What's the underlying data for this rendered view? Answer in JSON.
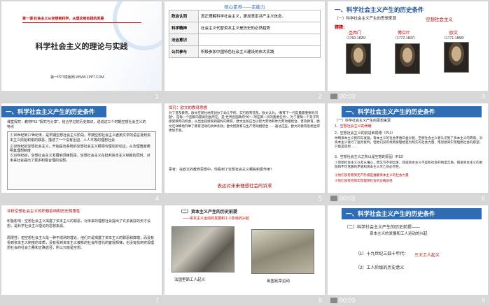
{
  "slides": [
    {
      "num": "1",
      "title": "科学社会主义的理论与实践",
      "lesson": "第一课  社会主义从空想到科学、从理论到实践的发展",
      "footer": "第一PPT模板网-WWW.1PPT.COM"
    },
    {
      "num": "2",
      "heading": "核心素养——定能力",
      "rows": [
        {
          "k": "政治认同",
          "v": "真正理解科学社会主义，更加坚定共产主义信念。"
        },
        {
          "k": "科学精神",
          "v": "社会主义代替资本主义是历史的必然趋势"
        },
        {
          "k": "法治意识",
          "v": ""
        },
        {
          "k": "公共参与",
          "v": "积极参加中国特色社会主义建设的伟大实践"
        }
      ]
    },
    {
      "num": "3",
      "time": "00:03",
      "heading": "一、科学社会主义产生的历史条件",
      "sub1": "（一）科学社会主义产生的思想来源",
      "sub2": "空想社会主义",
      "tag": "猜猜：",
      "people": [
        {
          "name": "圣西门",
          "years": "（1760-1825）"
        },
        {
          "name": "傅立叶",
          "years": "（1772-1837）"
        },
        {
          "name": "欧文",
          "years": "（1771-1858）"
        }
      ]
    },
    {
      "num": "4",
      "heading": "一、科学社会主义产生的历史条件",
      "q": "课堂探究：教材P11 \"探究与分享\"，结合学过的历史知识，说说这三个时期空想社会主义的特点",
      "items": [
        "①16世纪到17世纪末，是早期空想社会主义阶段。早期空想社会主义者用文学的语言批判资本主义原始积累的罪恶，描述了一个没有压迫、人人平等的理想社会",
        "②18世纪的空想社会主义，开始提出系统的空想社会主义纲领与理论的论证，从法理角度阐明其理想制度",
        "③19世纪初，空想社会主义发展到顶峰阶段，空想社会主义在批判资本主义制度的同时，对未来社会提出了更多积极合理的设想。"
      ]
    },
    {
      "num": "5",
      "title": "探究：欧文的教育思想",
      "body": "为了普及教育，欧文在新拉纳克创办了幼儿学校，实行教育普及。欧文认为，\"教育下一代是最最重要的问题\"，是每一个国家的最高利益所在，是\"世界各国政府\"的\"一项压倒一切的重要任务\"。为了使每一个孩子有接受教育的机会，从出生就接受到最好的教育，欧文主张应当以智力劳动和体力劳动相结合，普及教育。欧文还详细地列举了教育活动的具体条款。欧文把教育与生产劳动相结合……通过这些，欧文的教育思想显得更加丰富。",
      "question": "思考：在欧文的教育思想中，你看到了空想社会主义哪些积极作用？",
      "caption": "表达对未来理想社会的诉求"
    },
    {
      "num": "6",
      "time": "00:03",
      "heading": "一、科学社会主义产生的历史条件",
      "sub1": "（一）科学社会主义产生的思想来源",
      "tag": "1、空想社会主义的贡献",
      "p2": "2、空想社会主义的前进和局限（P11）",
      "p2body": "仲晴资本主义民间与发展，资本主义的社会矛盾日益尖锐，空想社会主义者认识到了资本主义的弊病，对资本主义进行了猛烈批判，但他们没有找到将理想变为现实的社会力量，用思想来实现理想社会的愿望，只能是空想……",
      "p3": "3、空想社会主义之所以是空想的原因（P12）",
      "p3items": [
        "①空想社会主义以及从唯心，而又写不到出发，得提资本主义不是和社会的制度实质，揭发资本主义的剥削和不可克服的矛盾和资本主义灭亡的必然性。",
        "②他们没有看到无产阶级是推翻资本主义的社会力量",
        "③他们没有找到实现理想社会的正确途径"
      ]
    },
    {
      "num": "7",
      "title": "评析空想社会主义的积极影响和历史局限性",
      "p1": "积极影响：空想社会主义揭露了资本主义的罪恶，对未来的理想社会提出了许多美好的天才设想，是科学社会主义理论的思想来源。",
      "p2": "局限性：但空想社会主义是一种不成熟的理论，他们只是揭露了资本主义的罪恶和弊端，而没有看到资本主义制度的本质，没有看到资本主义被新的社会所替代的客观规律，也没有找到实现理想社会的社会力量和正确途径，所以只能是空想。"
    },
    {
      "num": "8",
      "heading": "（二）资本主义产生的历史前提",
      "sub": "——资本主义运动的发展和工人阶级的兴起",
      "cap1": "法国里昂工人起义",
      "cap2": "英国宪章运动"
    },
    {
      "num": "9",
      "time": "00:03",
      "heading": "一、科学社会主义产生的历史条件",
      "sub": "（二）科学社会主义产生的历史前提——",
      "sub2": "资本主义的发展和工人运动的兴起",
      "l1": "（1）十九世纪三四十年代：",
      "l1r": "三大工人起义",
      "l2": "（2）工人阶级的历史意义"
    }
  ]
}
